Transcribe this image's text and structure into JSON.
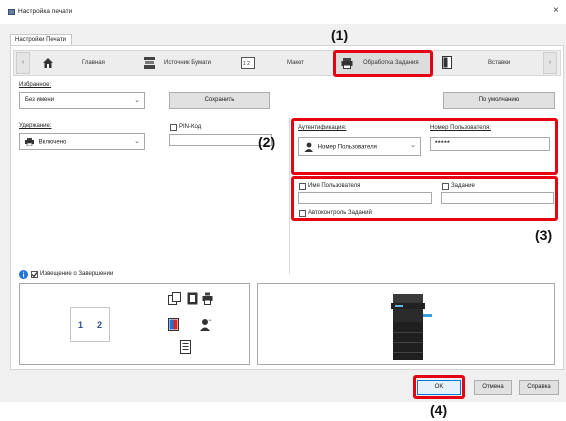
{
  "window": {
    "title": "Настройка печати",
    "close_glyph": "×",
    "tab": "Настройки Печати"
  },
  "toolbar": {
    "scroll_left_glyph": "‹",
    "scroll_right_glyph": "›",
    "tabs": [
      {
        "label": "Главная",
        "icon": "home-icon"
      },
      {
        "label": "Источник Бумаги",
        "icon": "paper-tray-icon"
      },
      {
        "label": "Макет",
        "icon": "layout-icon"
      },
      {
        "label": "Обработка Задания",
        "icon": "job-handling-icon"
      },
      {
        "label": "Вставки",
        "icon": "inserts-icon"
      }
    ]
  },
  "favorites": {
    "label": "Избранное:",
    "value": "Без имени",
    "save_label": "Сохранить",
    "default_label": "По умолчанию"
  },
  "retention": {
    "label": "Удержание:",
    "value": "Включено",
    "pin_label": "PIN-Код"
  },
  "auth": {
    "label": "Аутентификация:",
    "value": "Номер Пользователя",
    "user_number_label": "Номер Пользователя:",
    "user_number_value": "*****"
  },
  "user_fields": {
    "user_name_label": "Имя Пользователя",
    "job_name_label": "Задание",
    "job_control_label": "Автоконтроль Заданий"
  },
  "notification": {
    "label": "Извещение о Завершении"
  },
  "preview": {
    "pages": [
      "1",
      "2"
    ]
  },
  "callouts": [
    "(1)",
    "(2)",
    "(3)",
    "(4)"
  ],
  "buttons": {
    "ok": "OK",
    "cancel": "Отмена",
    "help": "Справка"
  },
  "colors": {
    "highlight": "#e60012",
    "info": "#1e73d8"
  }
}
